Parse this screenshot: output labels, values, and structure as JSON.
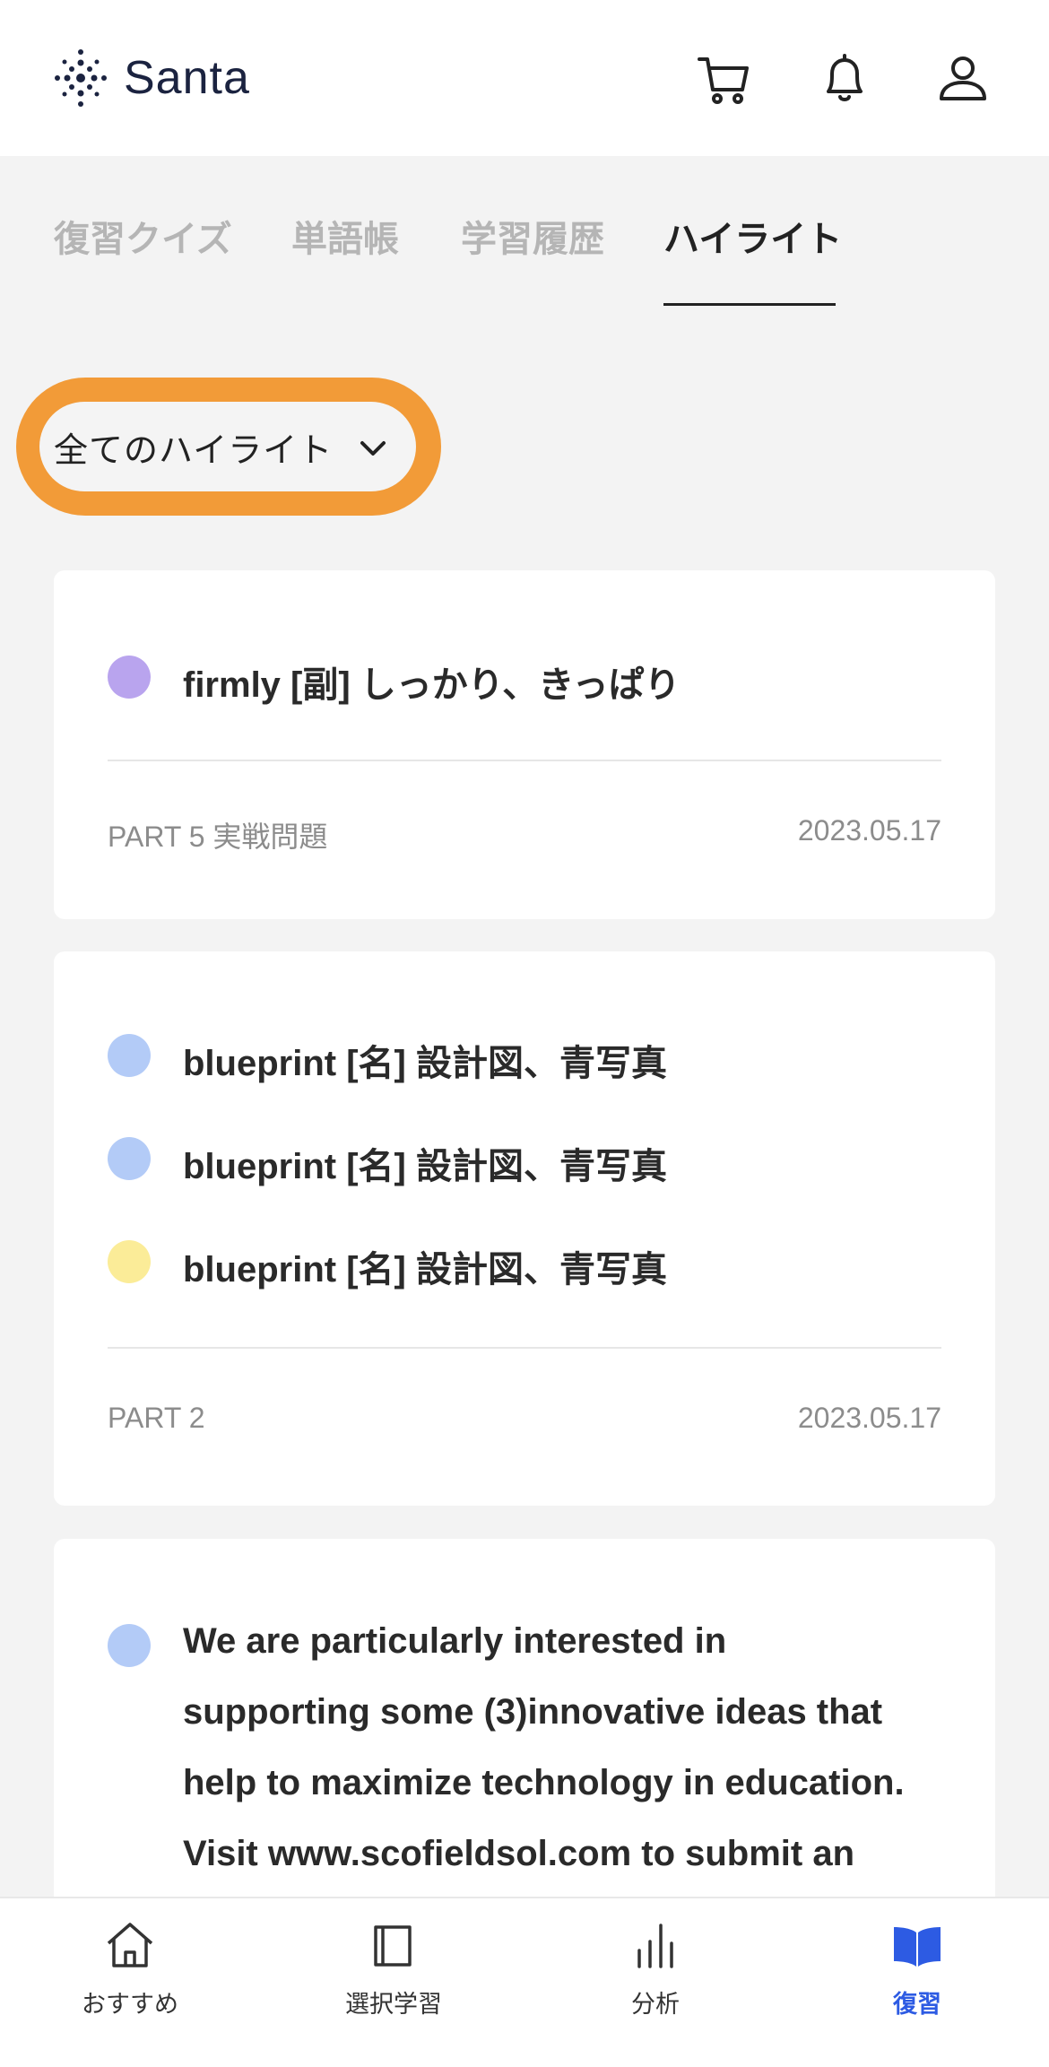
{
  "header": {
    "logo_text": "Santa",
    "icons": [
      "cart-icon",
      "bell-icon",
      "user-icon"
    ]
  },
  "tabs": [
    {
      "label": "復習クイズ",
      "active": false
    },
    {
      "label": "単語帳",
      "active": false
    },
    {
      "label": "学習履歴",
      "active": false
    },
    {
      "label": "ハイライト",
      "active": true
    }
  ],
  "filter": {
    "label": "全てのハイライト",
    "highlight_ring_color": "#f29b38"
  },
  "cards": [
    {
      "items": [
        {
          "color": "#b9a4ee",
          "text": "firmly [副] しっかり、きっぱり"
        }
      ],
      "source": "PART 5 実戦問題",
      "date": "2023.05.17"
    },
    {
      "items": [
        {
          "color": "#b3cbf7",
          "text": "blueprint [名] 設計図、青写真"
        },
        {
          "color": "#b3cbf7",
          "text": "blueprint [名] 設計図、青写真"
        },
        {
          "color": "#fbec98",
          "text": "blueprint [名] 設計図、青写真"
        }
      ],
      "source": "PART 2",
      "date": "2023.05.17"
    },
    {
      "items": [
        {
          "color": "#b3cbf7",
          "text": "We are particularly interested in supporting some (3)innovative ideas that help to maximize technology in education. Visit www.scofieldsol.com to submit an"
        }
      ]
    }
  ],
  "bottom_nav": [
    {
      "label": "おすすめ",
      "icon": "home-icon",
      "active": false
    },
    {
      "label": "選択学習",
      "icon": "book-outline-icon",
      "active": false
    },
    {
      "label": "分析",
      "icon": "bar-chart-icon",
      "active": false
    },
    {
      "label": "復習",
      "icon": "open-book-icon",
      "active": true
    }
  ],
  "colors": {
    "accent_blue": "#2d5be3",
    "text_dark": "#222222",
    "tab_inactive": "#b5b5b5"
  }
}
